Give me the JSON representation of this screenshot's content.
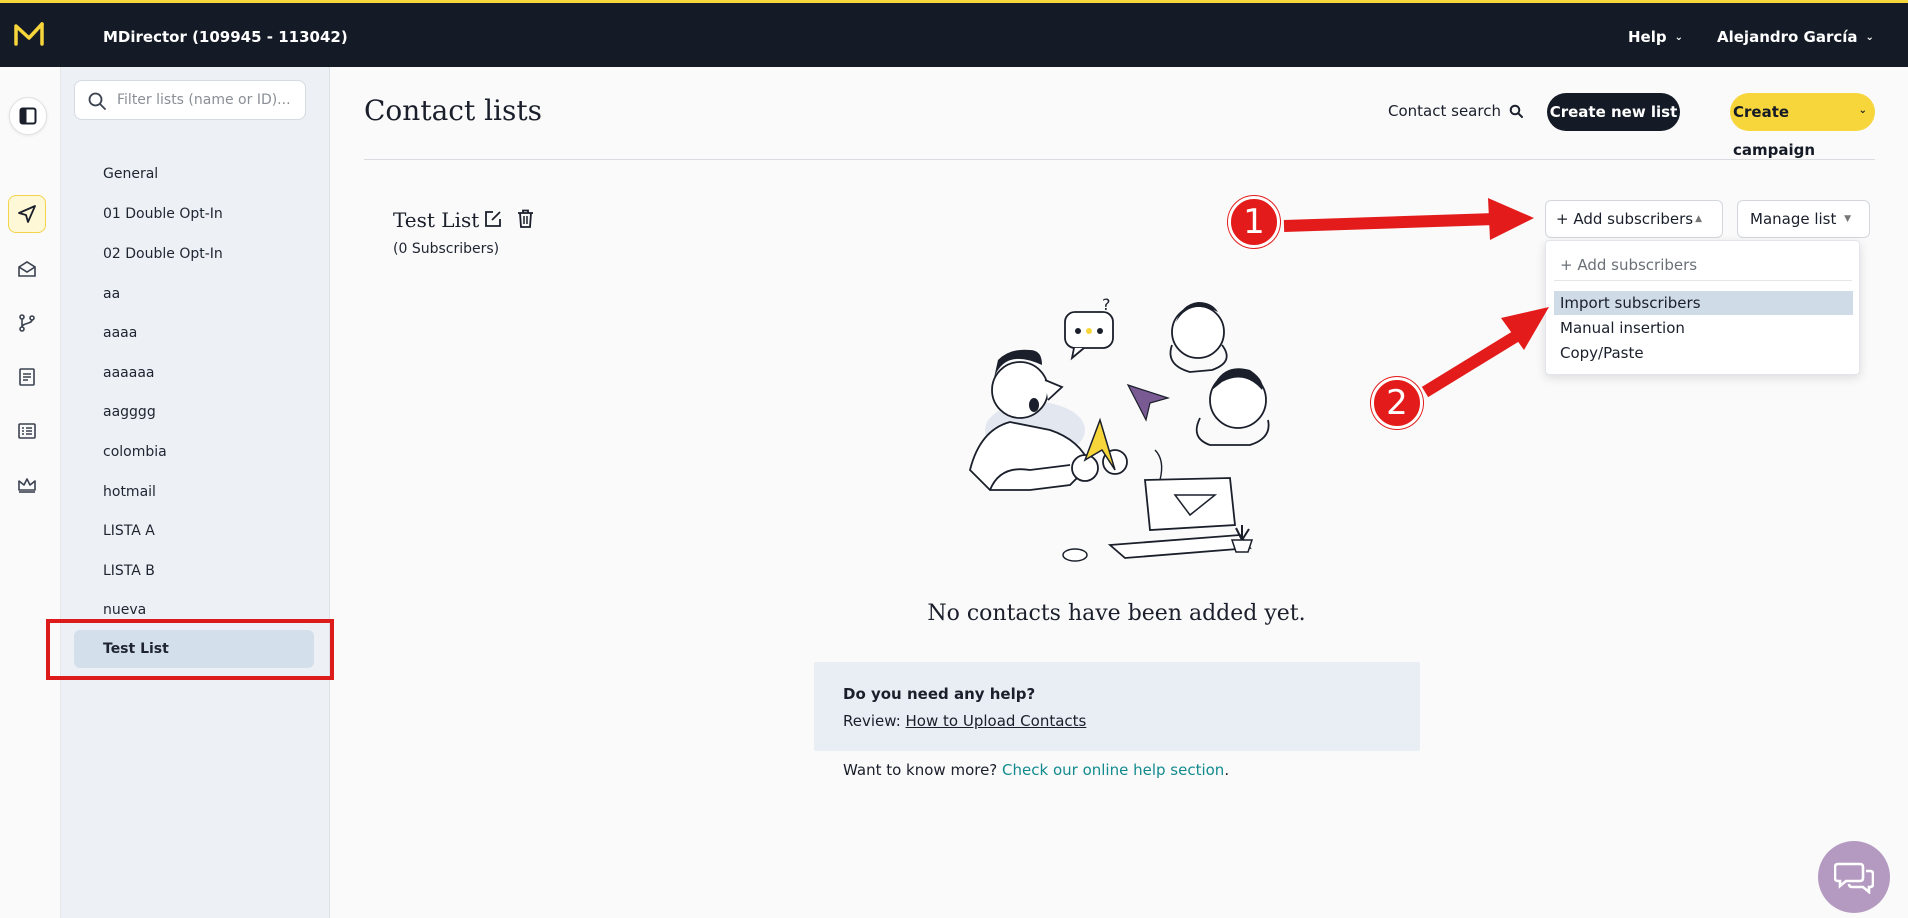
{
  "app": {
    "title": "MDirector (109945 - 113042)",
    "help_label": "Help",
    "user_label": "Alejandro García",
    "brand_color": "#f7d63c"
  },
  "rail": {
    "icons": [
      "sidebar-toggle-icon",
      "send-icon",
      "mail-open-icon",
      "branch-icon",
      "document-icon",
      "list-icon",
      "crown-icon"
    ]
  },
  "sidebar": {
    "search_placeholder": "Filter lists (name or ID)...",
    "items": [
      {
        "label": "General"
      },
      {
        "label": "01 Double Opt-In"
      },
      {
        "label": "02 Double Opt-In"
      },
      {
        "label": "aa"
      },
      {
        "label": "aaaa"
      },
      {
        "label": "aaaaaa"
      },
      {
        "label": "aagggg"
      },
      {
        "label": "colombia"
      },
      {
        "label": "hotmail"
      },
      {
        "label": "LISTA A"
      },
      {
        "label": "LISTA B"
      },
      {
        "label": "nueva"
      },
      {
        "label": "Test List"
      }
    ],
    "selected": "Test List"
  },
  "header": {
    "page_title": "Contact lists",
    "contact_search_label": "Contact search",
    "create_list_label": "Create new list",
    "create_campaign_label": "Create campaign"
  },
  "list": {
    "name": "Test List",
    "subscribers": "(0 Subscribers)",
    "add_subscribers_label": "+ Add subscribers",
    "manage_list_label": "Manage list"
  },
  "dropdown": {
    "header": "+ Add subscribers",
    "items": [
      {
        "label": "Import subscribers"
      },
      {
        "label": "Manual insertion"
      },
      {
        "label": "Copy/Paste"
      }
    ],
    "highlighted": "Import subscribers"
  },
  "empty_state": {
    "message": "No contacts have been added yet.",
    "help_title": "Do you need any help?",
    "review_prefix": "Review: ",
    "review_link": "How to Upload Contacts",
    "more_prefix": "Want to know more? ",
    "more_link": "Check our online help section",
    "more_suffix": "."
  },
  "annotations": {
    "badge1": "1",
    "badge2": "2",
    "color": "#e31b1b"
  }
}
